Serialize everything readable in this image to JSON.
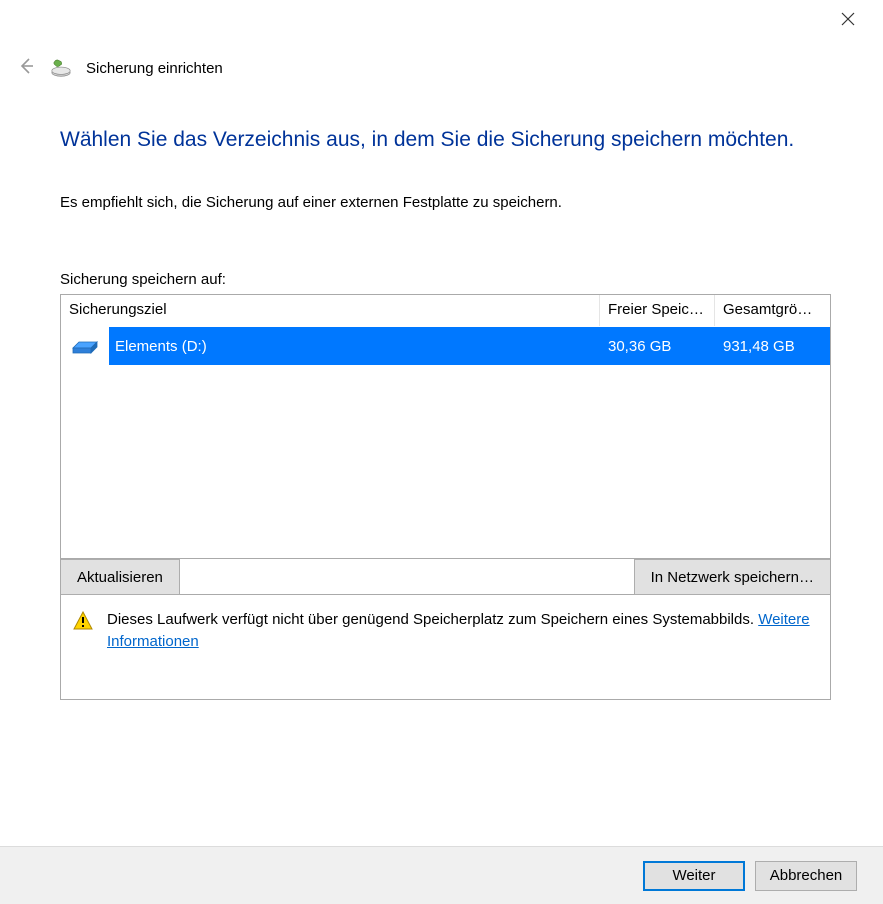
{
  "wizard": {
    "title": "Sicherung einrichten"
  },
  "heading": "Wählen Sie das Verzeichnis aus, in dem Sie die Sicherung speichern möchten.",
  "subtext": "Es empfiehlt sich, die Sicherung auf einer externen Festplatte zu speichern.",
  "list_label": "Sicherung speichern auf:",
  "columns": {
    "target": "Sicherungsziel",
    "free": "Freier Speic…",
    "total": "Gesamtgrö…"
  },
  "drives": [
    {
      "name": "Elements (D:)",
      "free": "30,36 GB",
      "total": "931,48 GB",
      "selected": true
    }
  ],
  "buttons": {
    "refresh": "Aktualisieren",
    "network": "In Netzwerk speichern…"
  },
  "warning": {
    "text": "Dieses Laufwerk verfügt nicht über genügend Speicherplatz zum Speichern eines Systemabbilds. ",
    "link": "Weitere Informationen"
  },
  "footer": {
    "next": "Weiter",
    "cancel": "Abbrechen"
  }
}
